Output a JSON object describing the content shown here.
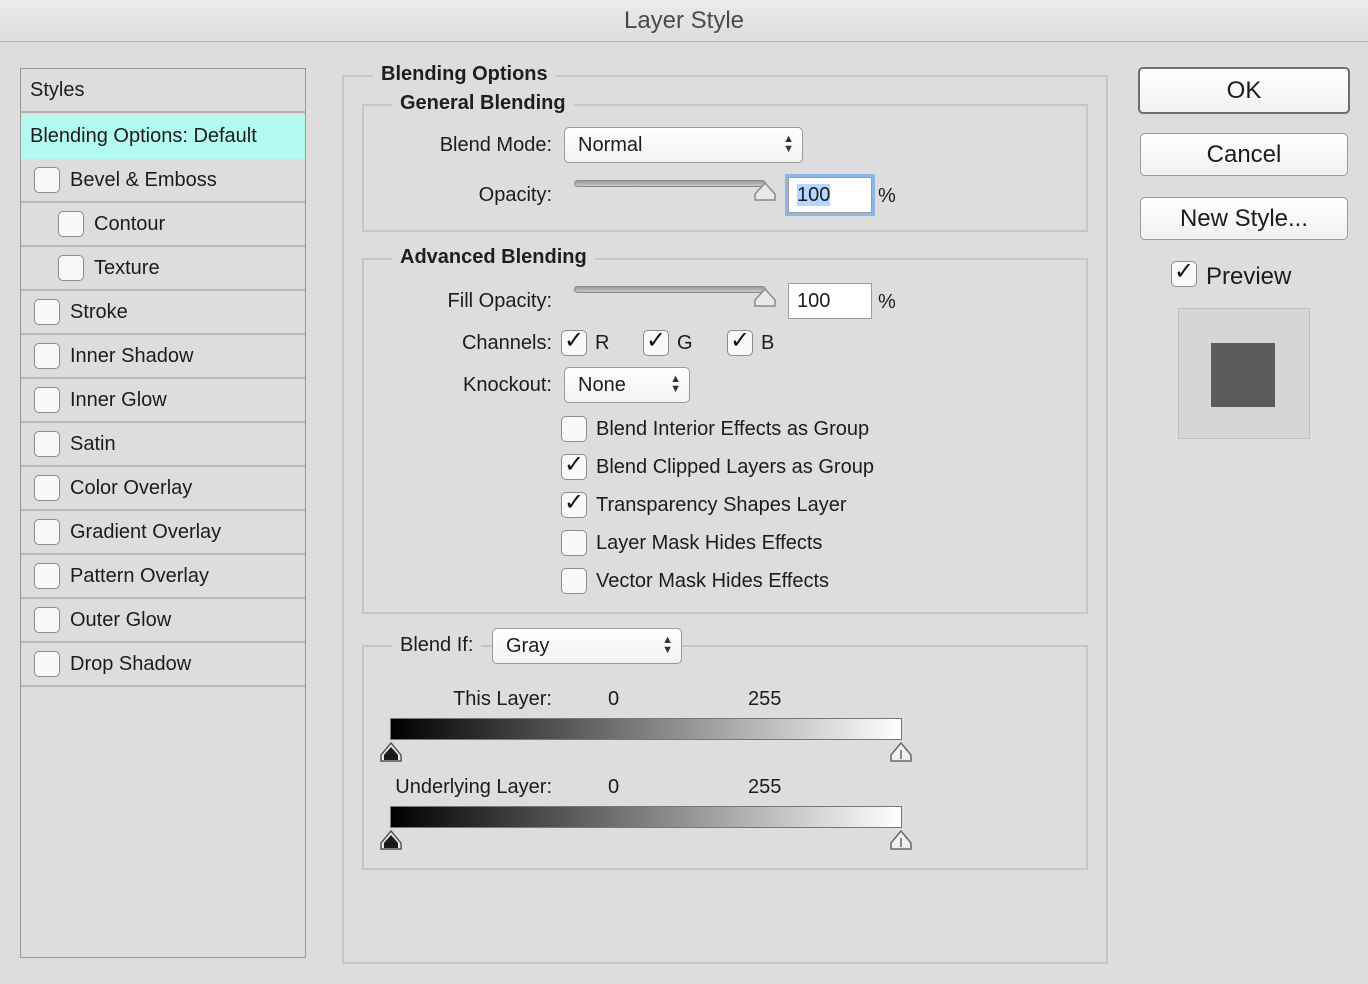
{
  "window": {
    "title": "Layer Style"
  },
  "styles_panel": {
    "header": "Styles",
    "items": [
      {
        "label": "Blending Options: Default",
        "has_checkbox": false,
        "checked": false,
        "selected": true
      },
      {
        "label": "Bevel & Emboss",
        "has_checkbox": true,
        "checked": false,
        "selected": false
      },
      {
        "label": "Contour",
        "has_checkbox": true,
        "checked": false,
        "selected": false
      },
      {
        "label": "Texture",
        "has_checkbox": true,
        "checked": false,
        "selected": false
      },
      {
        "label": "Stroke",
        "has_checkbox": true,
        "checked": false,
        "selected": false
      },
      {
        "label": "Inner Shadow",
        "has_checkbox": true,
        "checked": false,
        "selected": false
      },
      {
        "label": "Inner Glow",
        "has_checkbox": true,
        "checked": false,
        "selected": false
      },
      {
        "label": "Satin",
        "has_checkbox": true,
        "checked": false,
        "selected": false
      },
      {
        "label": "Color Overlay",
        "has_checkbox": true,
        "checked": false,
        "selected": false
      },
      {
        "label": "Gradient Overlay",
        "has_checkbox": true,
        "checked": false,
        "selected": false
      },
      {
        "label": "Pattern Overlay",
        "has_checkbox": true,
        "checked": false,
        "selected": false
      },
      {
        "label": "Outer Glow",
        "has_checkbox": true,
        "checked": false,
        "selected": false
      },
      {
        "label": "Drop Shadow",
        "has_checkbox": true,
        "checked": false,
        "selected": false
      }
    ]
  },
  "blending_options": {
    "title": "Blending Options",
    "general": {
      "title": "General Blending",
      "blend_mode_label": "Blend Mode:",
      "blend_mode_value": "Normal",
      "opacity_label": "Opacity:",
      "opacity_value": "100",
      "opacity_unit": "%"
    },
    "advanced": {
      "title": "Advanced Blending",
      "fill_opacity_label": "Fill Opacity:",
      "fill_opacity_value": "100",
      "fill_opacity_unit": "%",
      "channels_label": "Channels:",
      "channels": [
        {
          "label": "R",
          "checked": true
        },
        {
          "label": "G",
          "checked": true
        },
        {
          "label": "B",
          "checked": true
        }
      ],
      "knockout_label": "Knockout:",
      "knockout_value": "None",
      "options": [
        {
          "label": "Blend Interior Effects as Group",
          "checked": false
        },
        {
          "label": "Blend Clipped Layers as Group",
          "checked": true
        },
        {
          "label": "Transparency Shapes Layer",
          "checked": true
        },
        {
          "label": "Layer Mask Hides Effects",
          "checked": false
        },
        {
          "label": "Vector Mask Hides Effects",
          "checked": false
        }
      ]
    },
    "blend_if": {
      "label": "Blend If:",
      "value": "Gray",
      "this_layer_label": "This Layer:",
      "this_layer_min": "0",
      "this_layer_max": "255",
      "underlying_layer_label": "Underlying Layer:",
      "underlying_layer_min": "0",
      "underlying_layer_max": "255"
    }
  },
  "buttons": {
    "ok": "OK",
    "cancel": "Cancel",
    "new_style": "New Style..."
  },
  "preview": {
    "label": "Preview",
    "checked": true,
    "swatch_color": "#5b5b5b"
  },
  "icons": {
    "checkmark": "✓",
    "select_arrows": "▲▼"
  }
}
